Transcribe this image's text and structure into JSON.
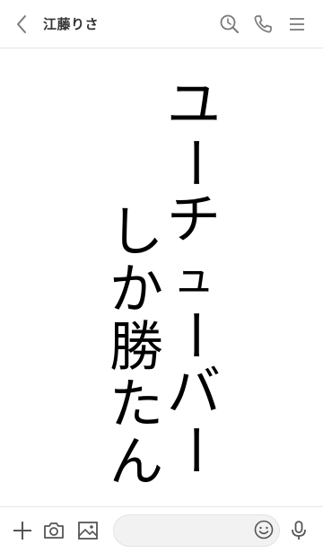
{
  "header": {
    "title": "江藤りさ",
    "icons": [
      "chevron-left-icon",
      "search-clock-icon",
      "phone-icon",
      "menu-icon"
    ]
  },
  "wallpaper": {
    "right_column": [
      "ユ",
      "ー",
      "チ",
      "ュ",
      "ー",
      "バ",
      "ー"
    ],
    "left_column": [
      "し",
      "か",
      "勝",
      "た",
      "ん"
    ]
  },
  "input_bar": {
    "icons": [
      "plus-icon",
      "camera-icon",
      "image-icon",
      "emoji-icon",
      "microphone-icon"
    ],
    "message_placeholder": ""
  },
  "colors": {
    "icon": "#7a7a7a",
    "title": "#333333",
    "divider": "#e6e6e6",
    "input_bg": "#f2f2f2"
  }
}
